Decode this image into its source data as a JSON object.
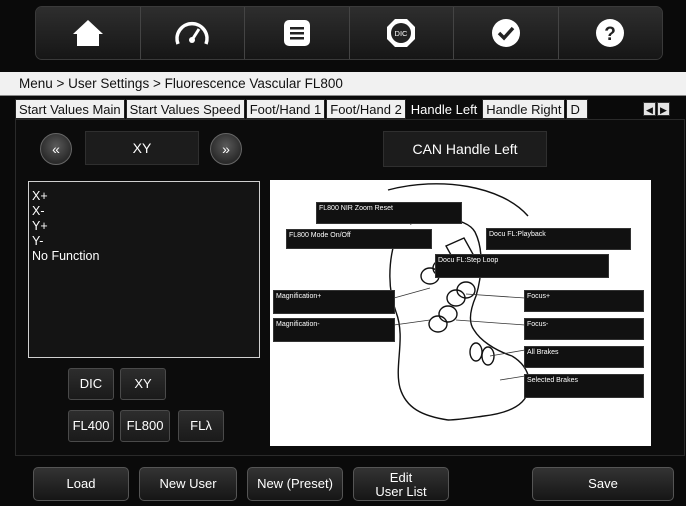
{
  "toolbar": {
    "icons": [
      "home-icon",
      "speedometer-icon",
      "menu-list-icon",
      "dic-icon",
      "checkmark-icon",
      "help-icon"
    ],
    "dic_text": "DIC",
    "help_text": "?"
  },
  "breadcrumb": "Menu > User Settings > Fluorescence Vascular FL800",
  "tabs": [
    "Start Values Main",
    "Start Values Speed",
    "Foot/Hand 1",
    "Foot/Hand 2",
    "Handle Left",
    "Handle Right",
    "D"
  ],
  "active_tab": "Handle Left",
  "selector": {
    "prev": "«",
    "next": "»",
    "value": "XY"
  },
  "handle_title": "CAN Handle Left",
  "functions": [
    "X+",
    "X-",
    "Y+",
    "Y-",
    "No Function"
  ],
  "mode_buttons": [
    "DIC",
    "XY",
    "FL400",
    "FL800",
    "FLλ"
  ],
  "diagram_labels": {
    "zoom_reset": "FL800 NIR Zoom Reset",
    "mode_onoff": "FL800 Mode On/Off",
    "playback": "Docu FL:Playback",
    "step_loop": "Docu FL:Step Loop",
    "mag_plus": "Magnification+",
    "mag_minus": "Magnification-",
    "focus_plus": "Focus+",
    "focus_minus": "Focus-",
    "all_brakes": "All Brakes",
    "selected_brakes": "Selected Brakes"
  },
  "bottom": {
    "load": "Load",
    "new_user": "New User",
    "new_preset": "New (Preset)",
    "edit_line1": "Edit",
    "edit_line2": "User List",
    "save": "Save"
  }
}
